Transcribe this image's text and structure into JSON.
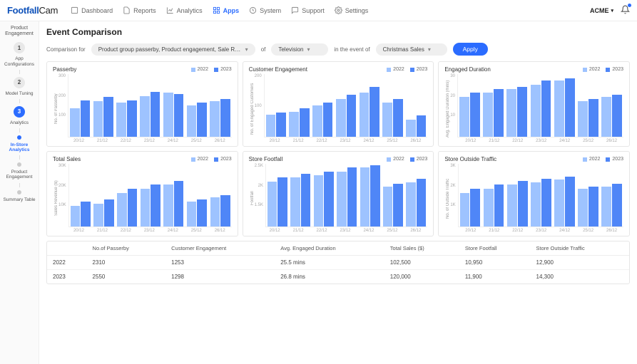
{
  "brand": {
    "a": "Footfall",
    "b": "Cam"
  },
  "nav": {
    "items": [
      {
        "label": "Dashboard"
      },
      {
        "label": "Reports"
      },
      {
        "label": "Analytics"
      },
      {
        "label": "Apps"
      },
      {
        "label": "System"
      },
      {
        "label": "Support"
      },
      {
        "label": "Settings"
      }
    ],
    "active": 3,
    "account": "ACME"
  },
  "sidebar": {
    "header": "Product Engagement",
    "steps": [
      {
        "num": "1",
        "label": "App Configurations"
      },
      {
        "num": "2",
        "label": "Model Tuning"
      },
      {
        "num": "3",
        "label": "Analytics"
      }
    ],
    "sub": [
      {
        "label": "In-Store Analytics",
        "active": true
      },
      {
        "label": "Product Engagement",
        "active": false
      },
      {
        "label": "Summary Table",
        "active": false
      }
    ]
  },
  "page": {
    "title": "Event Comparison"
  },
  "filter": {
    "prefix": "Comparison for",
    "metrics": "Product group passerby, Product engagement, Sale Revenue...",
    "of": "of",
    "category": "Television",
    "in": "in the event of",
    "event": "Christmas Sales",
    "apply": "Apply"
  },
  "legend": {
    "a": "2022",
    "b": "2023"
  },
  "xcats": [
    "20/12",
    "21/12",
    "22/12",
    "23/12",
    "24/12",
    "25/12",
    "26/12"
  ],
  "chart_data": [
    {
      "type": "bar",
      "title": "Passerby",
      "ylabel": "No. of Passerby",
      "ylim": [
        0,
        300
      ],
      "yticks": [
        "300",
        "200",
        "100"
      ],
      "categories": [
        "20/12",
        "21/12",
        "22/12",
        "23/12",
        "24/12",
        "25/12",
        "26/12"
      ],
      "series": [
        {
          "name": "2022",
          "values": [
            135,
            170,
            165,
            195,
            210,
            150,
            170
          ]
        },
        {
          "name": "2023",
          "values": [
            175,
            190,
            175,
            215,
            203,
            165,
            180
          ]
        }
      ]
    },
    {
      "type": "bar",
      "title": "Customer Engagement",
      "ylabel": "No. of Engaged Customers",
      "ylim": [
        0,
        200
      ],
      "yticks": [
        "200",
        "100"
      ],
      "categories": [
        "20/12",
        "21/12",
        "22/12",
        "23/12",
        "24/12",
        "25/12",
        "26/12"
      ],
      "series": [
        {
          "name": "2022",
          "values": [
            70,
            80,
            100,
            120,
            140,
            110,
            55
          ]
        },
        {
          "name": "2023",
          "values": [
            78,
            90,
            110,
            135,
            160,
            120,
            68
          ]
        }
      ]
    },
    {
      "type": "bar",
      "title": "Engaged Duration",
      "ylabel": "Avg. Engaged Duration (mins)",
      "ylim": [
        0,
        30
      ],
      "yticks": [
        "30",
        "20",
        "10"
      ],
      "categories": [
        "20/12",
        "21/12",
        "22/12",
        "23/12",
        "24/12",
        "25/12",
        "26/12"
      ],
      "series": [
        {
          "name": "2022",
          "values": [
            19,
            21,
            23,
            25,
            27,
            17,
            19
          ]
        },
        {
          "name": "2023",
          "values": [
            21,
            23,
            24,
            27,
            28,
            18,
            20
          ]
        }
      ]
    },
    {
      "type": "bar",
      "title": "Total Sales",
      "ylabel": "Sales Revenue ($)",
      "ylim": [
        0,
        30000
      ],
      "yticks": [
        "30K",
        "20K",
        "10K"
      ],
      "categories": [
        "20/12",
        "21/12",
        "22/12",
        "23/12",
        "24/12",
        "25/12",
        "26/12"
      ],
      "series": [
        {
          "name": "2022",
          "values": [
            10000,
            11000,
            16000,
            18000,
            20000,
            12000,
            14000
          ]
        },
        {
          "name": "2023",
          "values": [
            12000,
            13000,
            18000,
            20000,
            22000,
            13000,
            15000
          ]
        }
      ]
    },
    {
      "type": "bar",
      "title": "Store Footfall",
      "ylabel": "Footfall",
      "ylim": [
        0,
        2500
      ],
      "yticks": [
        "2.5K",
        "2K",
        "1.5K"
      ],
      "categories": [
        "20/12",
        "21/12",
        "22/12",
        "23/12",
        "24/12",
        "25/12",
        "26/12"
      ],
      "series": [
        {
          "name": "2022",
          "values": [
            1800,
            1950,
            2050,
            2200,
            2350,
            1600,
            1750
          ]
        },
        {
          "name": "2023",
          "values": [
            1950,
            2100,
            2200,
            2350,
            2450,
            1700,
            1900
          ]
        }
      ]
    },
    {
      "type": "bar",
      "title": "Store Outside Traffic",
      "ylabel": "No. of Outside Traffic",
      "ylim": [
        0,
        3000
      ],
      "yticks": [
        "3K",
        "2K",
        "1K"
      ],
      "categories": [
        "20/12",
        "21/12",
        "22/12",
        "23/12",
        "24/12",
        "25/12",
        "26/12"
      ],
      "series": [
        {
          "name": "2022",
          "values": [
            1600,
            1800,
            2000,
            2100,
            2250,
            1800,
            1900
          ]
        },
        {
          "name": "2023",
          "values": [
            1800,
            2000,
            2200,
            2300,
            2400,
            1900,
            2050
          ]
        }
      ]
    }
  ],
  "table": {
    "headers": [
      "",
      "No.of Passerby",
      "Customer Engagement",
      "Avg. Engaged Duration",
      "Total Sales ($)",
      "Store Footfall",
      "Store Outside Traffic"
    ],
    "rows": [
      [
        "2022",
        "2310",
        "1253",
        "25.5 mins",
        "102,500",
        "10,950",
        "12,900"
      ],
      [
        "2023",
        "2550",
        "1298",
        "26.8 mins",
        "120,000",
        "11,900",
        "14,300"
      ]
    ]
  }
}
